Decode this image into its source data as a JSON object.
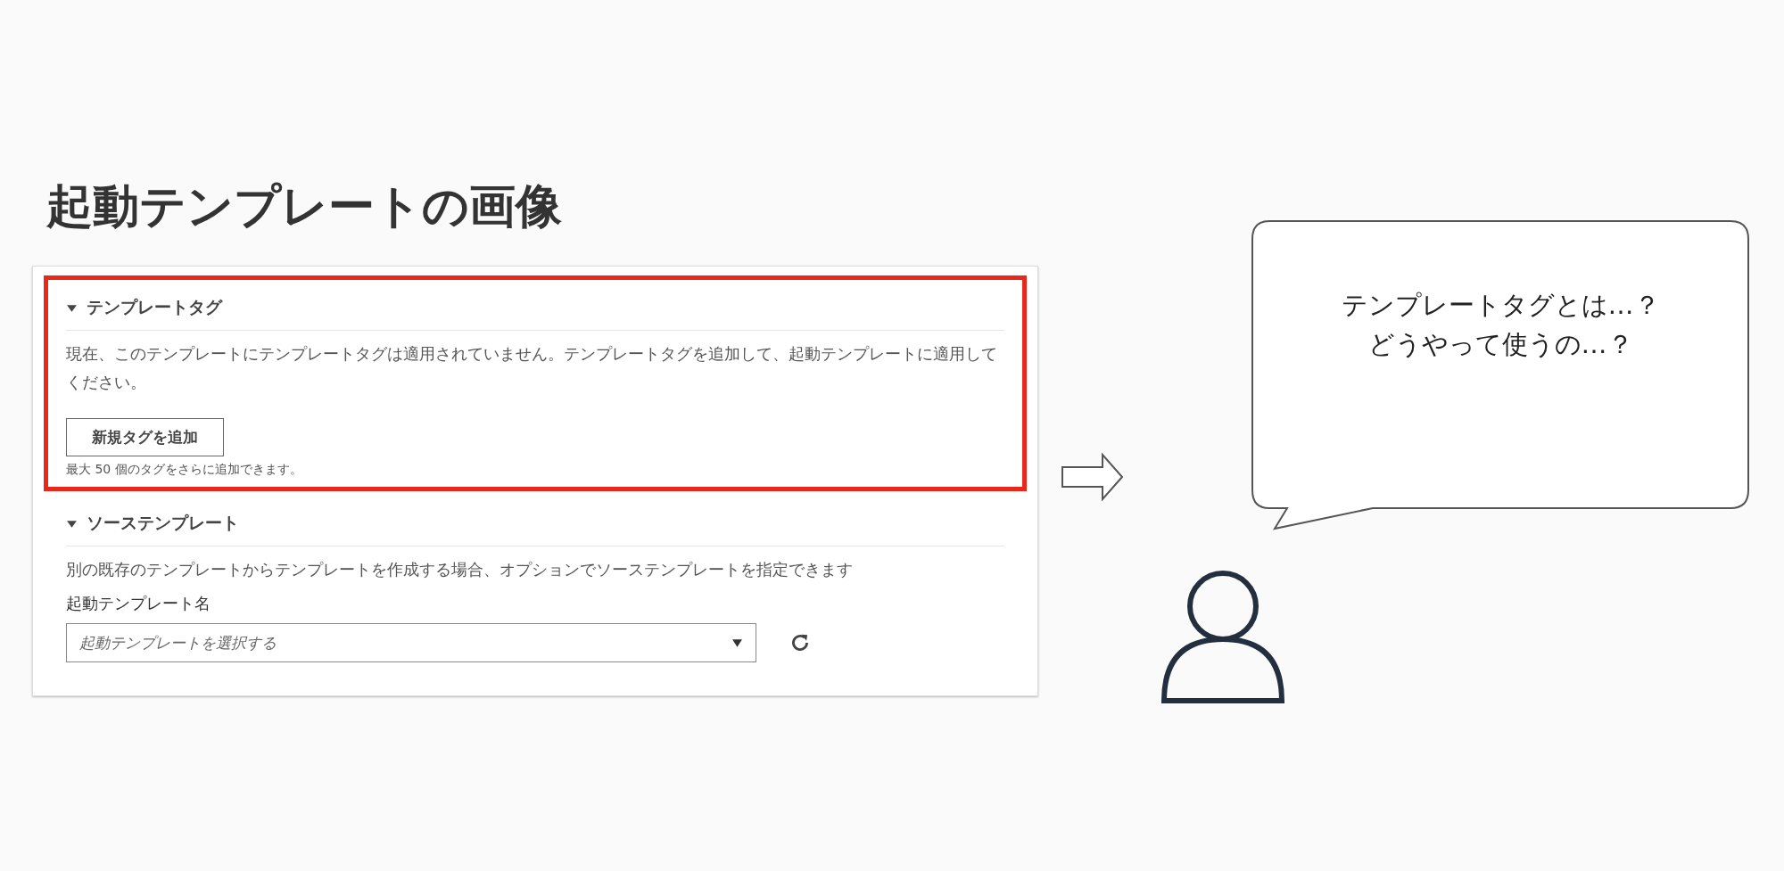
{
  "title": "起動テンプレートの画像",
  "console": {
    "sections": [
      {
        "kind": "tags",
        "heading": "テンプレートタグ",
        "expanded": true,
        "highlighted": true,
        "description": "現在、このテンプレートにテンプレートタグは適用されていません。テンプレートタグを追加して、起動テンプレートに適用してください。",
        "button": "新規タグを追加",
        "hint": "最大 50 個のタグをさらに追加できます。"
      },
      {
        "kind": "source",
        "heading": "ソーステンプレート",
        "expanded": true,
        "highlighted": false,
        "description": "別の既存のテンプレートからテンプレートを作成する場合、オプションでソーステンプレートを指定できます",
        "field_label": "起動テンプレート名",
        "select": {
          "placeholder": "起動テンプレートを選択する"
        }
      }
    ]
  },
  "speech_bubble": {
    "lines": [
      "テンプレートタグとは…？",
      "どうやって使うの…？"
    ]
  }
}
